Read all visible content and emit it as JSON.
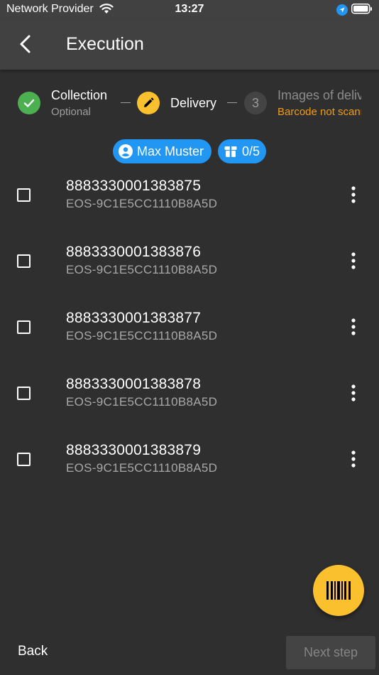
{
  "status_bar": {
    "carrier": "Network Provider",
    "time": "13:27"
  },
  "app_bar": {
    "title": "Execution"
  },
  "stepper": {
    "steps": [
      {
        "title": "Collection",
        "subtitle": "Optional",
        "state": "completed",
        "icon": "check-icon"
      },
      {
        "title": "Delivery",
        "state": "active",
        "icon": "pencil-icon"
      },
      {
        "number": "3",
        "title": "Images of delivery",
        "subtitle": "Barcode not scanned",
        "state": "pending"
      }
    ]
  },
  "chips": {
    "driver": "Max Muster",
    "count": "0/5"
  },
  "items": [
    {
      "barcode": "8883330001383875",
      "order": "EOS-9C1E5CC1110B8A5D"
    },
    {
      "barcode": "8883330001383876",
      "order": "EOS-9C1E5CC1110B8A5D"
    },
    {
      "barcode": "8883330001383877",
      "order": "EOS-9C1E5CC1110B8A5D"
    },
    {
      "barcode": "8883330001383878",
      "order": "EOS-9C1E5CC1110B8A5D"
    },
    {
      "barcode": "8883330001383879",
      "order": "EOS-9C1E5CC1110B8A5D"
    }
  ],
  "footer": {
    "back_label": "Back",
    "next_label": "Next step"
  },
  "colors": {
    "background": "#2f2f2f",
    "app_bar": "#414141",
    "accent_yellow": "#fbc02d",
    "success_green": "#4cb050",
    "chip_blue": "#2196f3",
    "warning_orange": "#f29b18"
  }
}
